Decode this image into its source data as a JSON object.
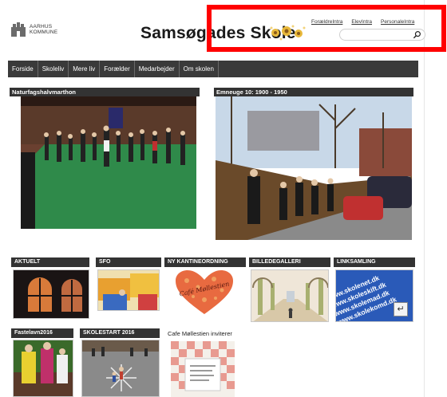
{
  "header": {
    "logo_line1": "AARHUS",
    "logo_line2": "KOMMUNE",
    "site_title": "Samsøgades Skole"
  },
  "top_links": [
    "ForældreIntra",
    "ElevIntra",
    "PersonaleIntra"
  ],
  "search": {
    "placeholder": ""
  },
  "nav": [
    "Forside",
    "Skoleliv",
    "Mere liv",
    "Forælder",
    "Medarbejder",
    "Om skolen"
  ],
  "featured": [
    {
      "title": "Naturfagshalvmarthon"
    },
    {
      "title": "Emneuge 10: 1900 - 1950"
    }
  ],
  "tiles": [
    {
      "title": "AKTUELT"
    },
    {
      "title": "SFO"
    },
    {
      "title": "NY KANTINEORDNING",
      "overlay": "Café Møllestien"
    },
    {
      "title": "BILLEDEGALLERI"
    },
    {
      "title": "LINKSAMLING",
      "overlay_lines": [
        "www.skolenet.dk",
        "www.skoleskift.dk",
        "www.skolemad.dk",
        "www.skolekomd.dk"
      ]
    },
    {
      "title": "Fastelavn2016"
    },
    {
      "title": "SKOLESTART 2016"
    },
    {
      "title": "Cafe Møllestien inviterer"
    }
  ],
  "colors": {
    "nav_bg": "#3a3a3a",
    "highlight": "#ff0000",
    "tile_bar": "#333333"
  }
}
